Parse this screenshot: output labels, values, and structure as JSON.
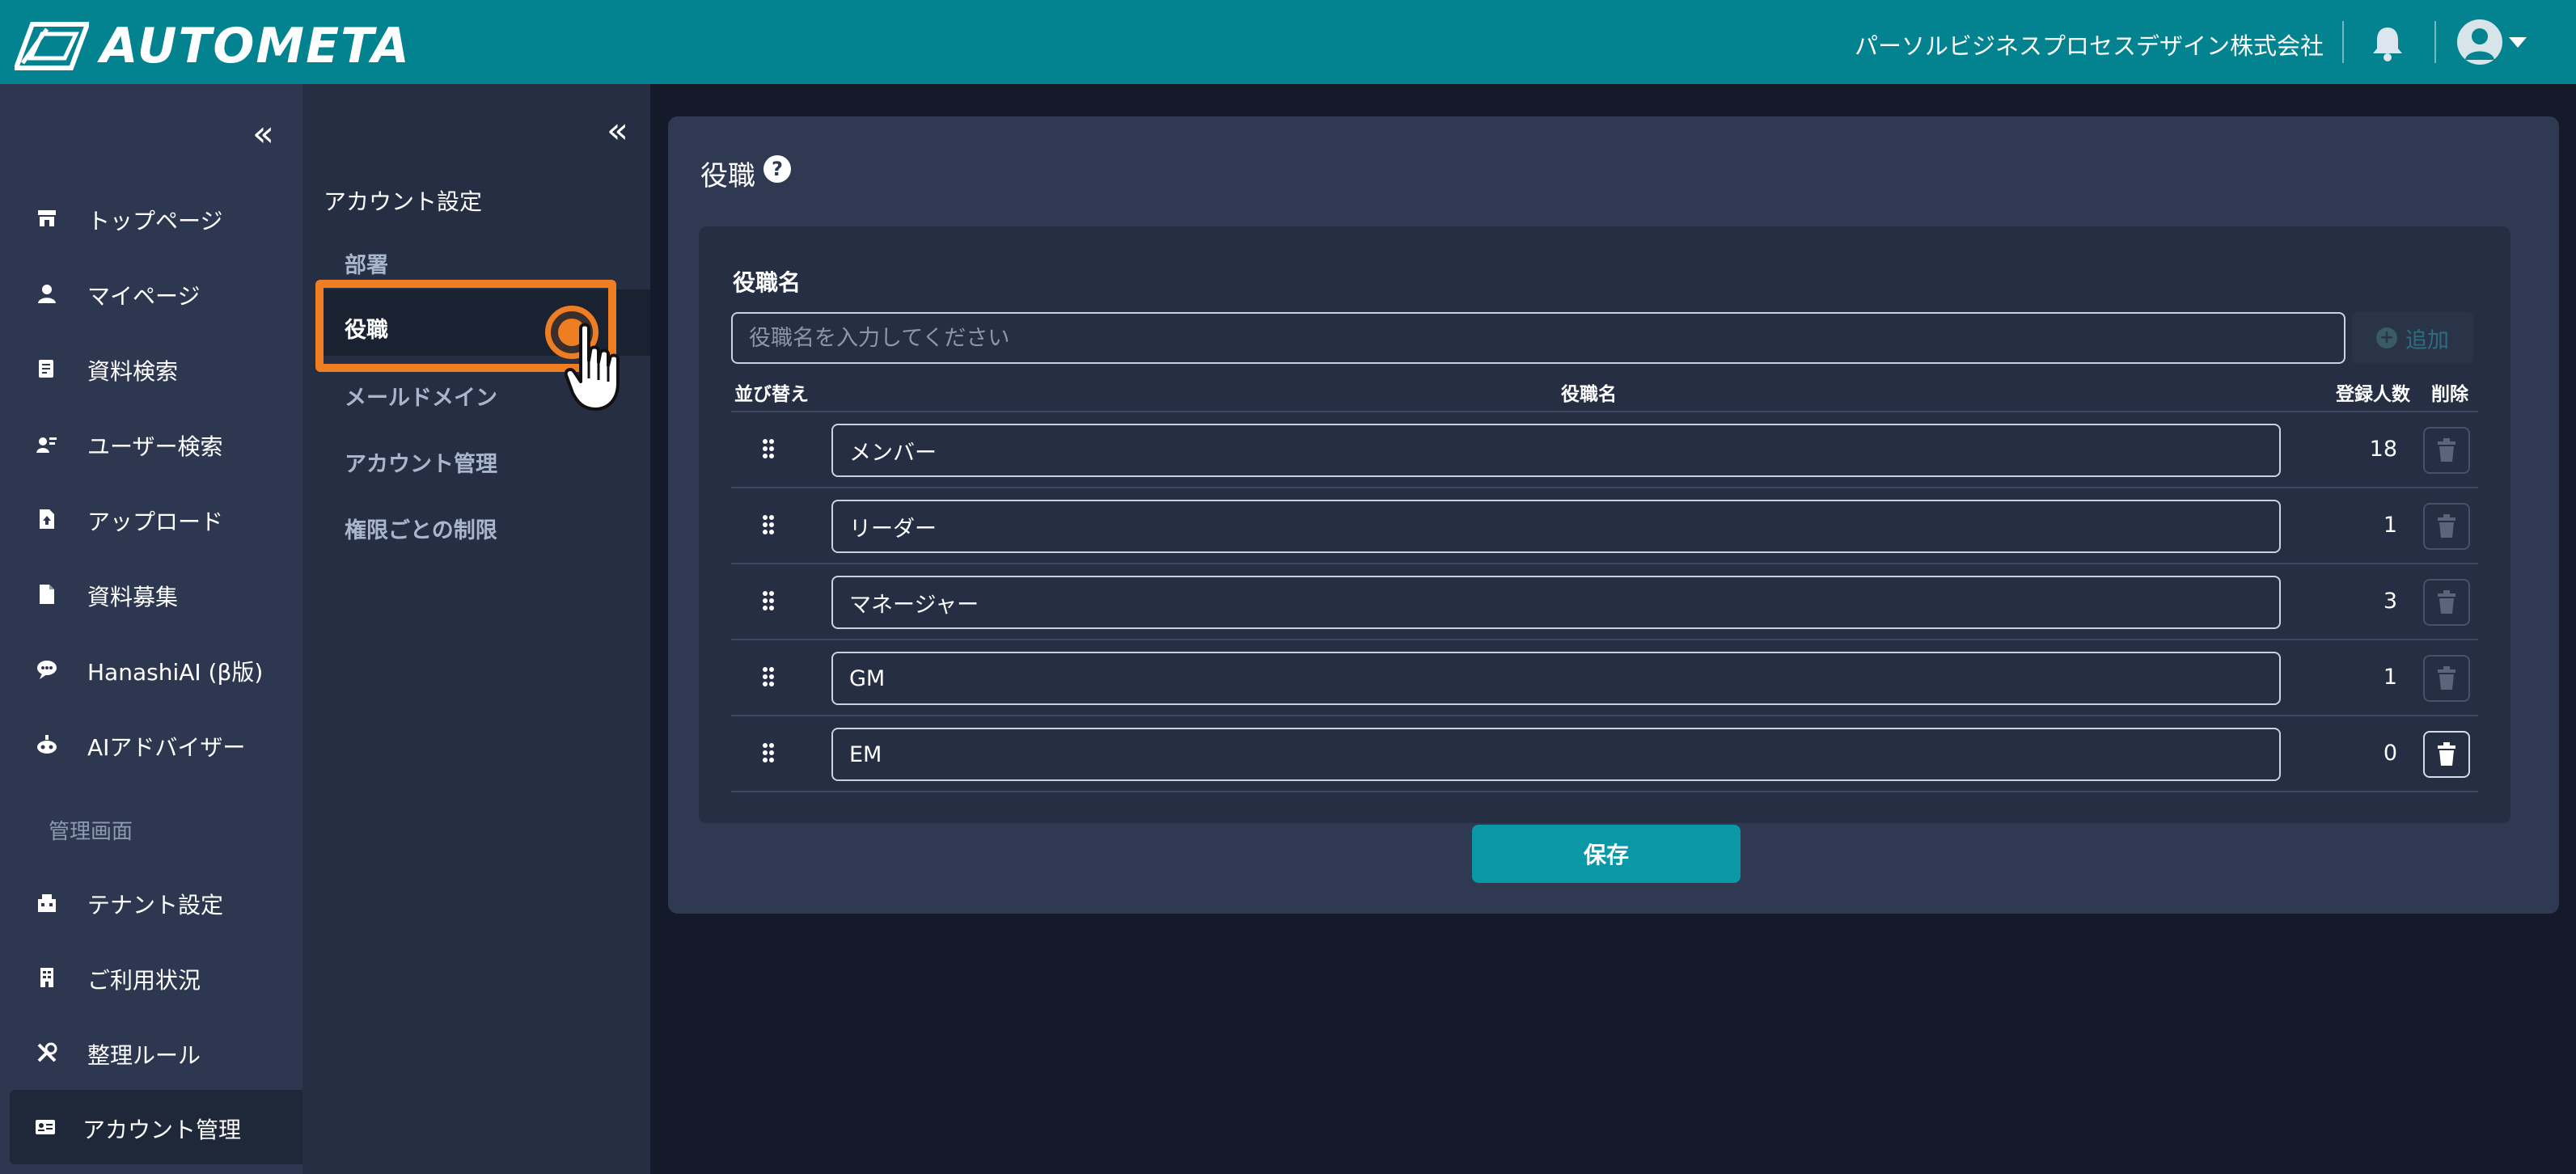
{
  "header": {
    "app_name": "AUTOMETA",
    "company": "パーソルビジネスプロセスデザイン株式会社",
    "accent_color": "#02838f"
  },
  "sidebar": {
    "items": [
      {
        "label": "トップページ",
        "icon": "store-icon"
      },
      {
        "label": "マイページ",
        "icon": "person-icon"
      },
      {
        "label": "資料検索",
        "icon": "document-search-icon"
      },
      {
        "label": "ユーザー検索",
        "icon": "user-search-icon"
      },
      {
        "label": "アップロード",
        "icon": "file-upload-icon"
      },
      {
        "label": "資料募集",
        "icon": "file-icon"
      },
      {
        "label": "HanashiAI (β版)",
        "icon": "chat-bubble-icon"
      },
      {
        "label": "AIアドバイザー",
        "icon": "robot-icon"
      }
    ],
    "admin_section": "管理画面",
    "admin_items": [
      {
        "label": "テナント設定",
        "icon": "tenant-icon"
      },
      {
        "label": "ご利用状況",
        "icon": "building-icon"
      },
      {
        "label": "整理ルール",
        "icon": "tools-icon"
      },
      {
        "label": "アカウント管理",
        "icon": "id-card-icon"
      }
    ]
  },
  "subsidebar": {
    "heading": "アカウント設定",
    "items": [
      "部署",
      "役職",
      "メールドメイン",
      "アカウント管理",
      "権限ごとの制限"
    ],
    "active": "役職",
    "highlight_color": "#ef7d22"
  },
  "main": {
    "title": "役職",
    "field_label": "役職名",
    "input_placeholder": "役職名を入力してください",
    "add_label": "追加",
    "columns": {
      "sort": "並び替え",
      "name": "役職名",
      "count": "登録人数",
      "delete": "削除"
    },
    "rows": [
      {
        "name": "メンバー",
        "count": "18"
      },
      {
        "name": "リーダー",
        "count": "1"
      },
      {
        "name": "マネージャー",
        "count": "3"
      },
      {
        "name": "GM",
        "count": "1"
      },
      {
        "name": "EM",
        "count": "0"
      }
    ],
    "save_label": "保存",
    "save_color": "#0a97a6"
  }
}
